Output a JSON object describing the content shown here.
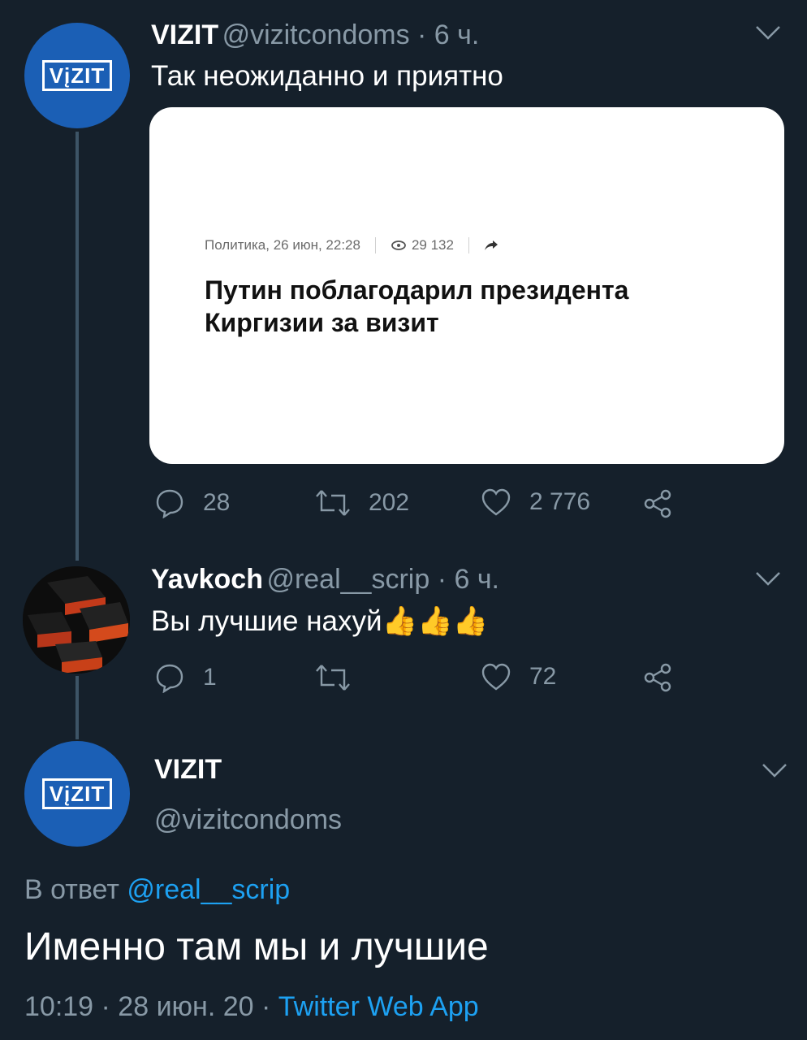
{
  "colors": {
    "background": "#15202b",
    "accent": "#1da1f2",
    "muted": "#8899a6",
    "avatar_blue": "#1b5fb5"
  },
  "tweet1": {
    "avatar_logo": "VįZIT",
    "name": "VIZIT",
    "handle_time": "@vizitcondoms · 6 ч.",
    "text": "Так неожиданно и приятно",
    "card": {
      "meta_category": "Политика, 26 июн, 22:28",
      "meta_views": "29 132",
      "headline_line1": "Путин поблагодарил президента",
      "headline_line2": "Киргизии за визит"
    },
    "actions": {
      "replies": "28",
      "retweets": "202",
      "likes": "2 776"
    }
  },
  "tweet2": {
    "name": "Yavkoch",
    "handle_time": "@real__scrip · 6 ч.",
    "text": "Вы лучшие нахуй",
    "emoji": "👍👍👍",
    "actions": {
      "replies": "1",
      "retweets": "",
      "likes": "72"
    }
  },
  "tweet3": {
    "avatar_logo": "VįZIT",
    "name": "VIZIT",
    "handle": "@vizitcondoms",
    "reply_prefix": "В ответ",
    "reply_handle": "@real__scrip",
    "text": "Именно там мы и лучшие",
    "timestamp": "10:19 · 28 июн. 20 · ",
    "source": "Twitter Web App"
  }
}
